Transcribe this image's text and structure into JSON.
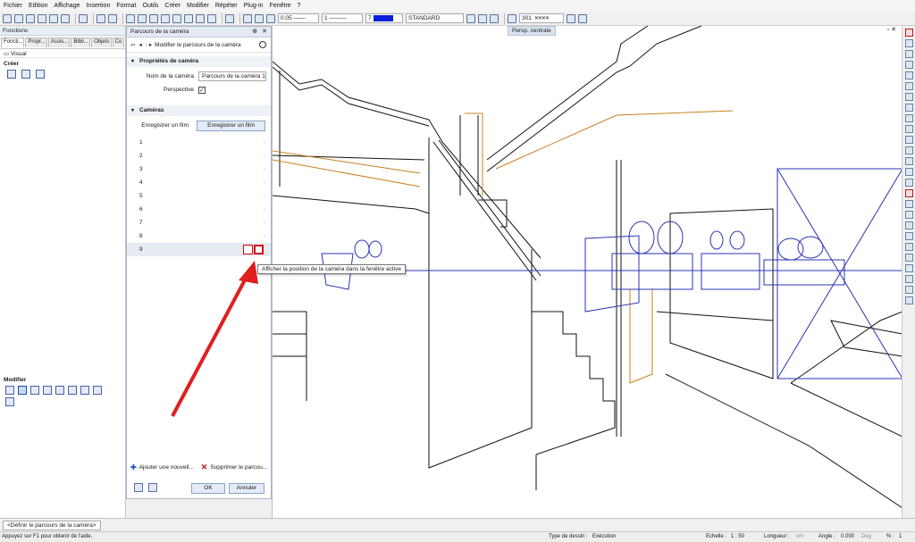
{
  "menu": [
    "Fichier",
    "Edition",
    "Affichage",
    "Insertion",
    "Format",
    "Outils",
    "Créer",
    "Modifier",
    "Répéter",
    "Plug-in",
    "Fenêtre",
    "?"
  ],
  "toolbar": {
    "pen_value": "0.05",
    "line_value": "1",
    "color_value": "7",
    "layer_value": "STANDARD",
    "scale_value": "301"
  },
  "fonctions_panel": {
    "title": "Fonctions",
    "tabs": [
      "Foncti...",
      "Propr...",
      "Assis...",
      "Bibli...",
      "Objets",
      "Co"
    ],
    "visual_label": "Visual",
    "creer_label": "Créer",
    "modifier_label": "Modifier"
  },
  "camera_panel": {
    "title": "Parcours de la caméra",
    "breadcrumb": "Modifier le parcours de la caméra",
    "section_properties": "Propriétés de caméra",
    "camera_name_label": "Nom de la caméra",
    "camera_name_value": "Parcours de la caméra 1",
    "perspective_label": "Perspective",
    "section_cameras": "Caméras",
    "record_film_label": "Enregistrer un film",
    "record_film_button": "Enregistrer un film",
    "rows": [
      "1",
      "2",
      "3",
      "4",
      "5",
      "6",
      "7",
      "8",
      "9"
    ],
    "add_action": "Ajouter une nouvell...",
    "delete_action": "Supprimer le parcou...",
    "ok_label": "OK",
    "cancel_label": "Annuler"
  },
  "tooltip": "Afficher la position de la caméra dans la fenêtre active",
  "viewport": {
    "view_label": "Persp. centrale"
  },
  "doc_tab": "<Définir le parcours de la caméra>",
  "status": {
    "help": "Appuyez sur F1 pour obtenir de l'aide.",
    "drawing_type_label": "Type de dessin :",
    "drawing_type_value": "Exécution",
    "scale_label": "Echelle :",
    "scale_value": "1 : 50",
    "length_label": "Longueur :",
    "length_unit": "cm",
    "angle_label": "Angle :",
    "angle_value": "0.000",
    "angle_unit": "Deg",
    "percent_label": "% :",
    "percent_value": "1"
  },
  "colors": {
    "accent": "#1c3fb8",
    "arrow": "#e01e1e",
    "orange_line": "#c8801c",
    "wire_blue": "#2a33b5"
  }
}
